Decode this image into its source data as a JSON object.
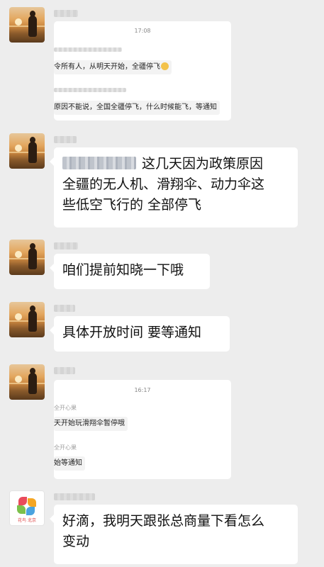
{
  "messages": [
    {
      "type": "card",
      "time": "17:08",
      "lines": [
        "令所有人，从明天开始，全疆停飞",
        "原因不能说，全国全疆停飞，什么时候能飞，等通知"
      ]
    },
    {
      "type": "text",
      "text_line1": "这几天因为政策原因",
      "text_line2": "全疆的无人机、滑翔伞、动力伞这",
      "text_line3": "些低空飞行的 全部停飞"
    },
    {
      "type": "text",
      "text": "咱们提前知晓一下哦"
    },
    {
      "type": "text",
      "text": "具体开放时间 要等通知"
    },
    {
      "type": "card",
      "time": "16:17",
      "sender1": "全开心果",
      "line1": "天开始玩滑翔伞暂停哦",
      "sender2": "全开心果",
      "line2": "始等通知"
    },
    {
      "type": "text",
      "avatar_text": "花鸟 北京",
      "text_line1": "好滴，我明天跟张总商量下看怎么",
      "text_line2": "变动"
    }
  ],
  "icons": {
    "avatar_1": "sunset-avatar-icon",
    "avatar_logo": "pinwheel-logo-icon",
    "emoji": "smile-emoji-icon"
  },
  "colors": {
    "background": "#ededed",
    "bubble": "#ffffff",
    "card_inner": "#f3f3f3"
  }
}
